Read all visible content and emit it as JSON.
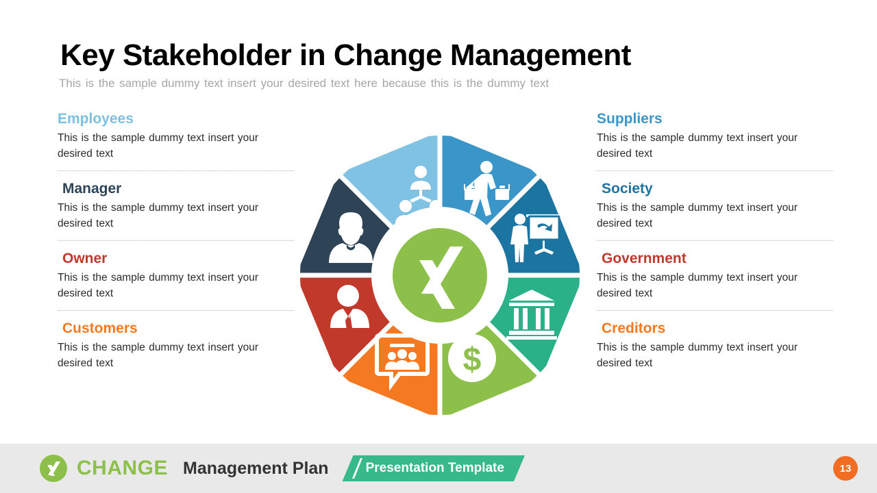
{
  "header": {
    "title": "Key Stakeholder in Change Management",
    "subtitle": "This is the sample  dummy  text insert your desired text here because this is the  dummy  text"
  },
  "body_text": "This is the sample dummy text insert your desired text",
  "left_column": [
    {
      "label": "Employees",
      "color": "#7dc0e0",
      "text": "This is the sample dummy text insert your desired text",
      "icon": "team-org-chart-icon"
    },
    {
      "label": "Manager",
      "color": "#2e4356",
      "text": "This is the sample dummy text insert your desired text",
      "icon": "person-bust-icon"
    },
    {
      "label": "Owner",
      "color": "#c0392b",
      "text": "This is the sample dummy text insert your desired text",
      "icon": "businessman-suit-icon"
    },
    {
      "label": "Customers",
      "color": "#f47920",
      "text": "This is the sample dummy text insert your desired text",
      "icon": "speech-bubble-people-icon"
    }
  ],
  "right_column": [
    {
      "label": "Suppliers",
      "color": "#3a96c8",
      "text": "This is the sample dummy text insert your desired text",
      "icon": "walking-briefcases-icon"
    },
    {
      "label": "Society",
      "color": "#1c74a0",
      "text": "This is the sample dummy text insert your desired text",
      "icon": "presenter-board-icon"
    },
    {
      "label": "Government",
      "color": "#c0392b",
      "text": "This is the sample dummy text insert your desired text",
      "icon": "bank-building-icon"
    },
    {
      "label": "Creditors",
      "color": "#f47920",
      "text": "This is the sample dummy text insert your desired text",
      "icon": "dollar-coin-icon"
    }
  ],
  "wheel": {
    "center_icon": "xing-logo-icon",
    "center_color": "#8cc04a",
    "segments": [
      {
        "name": "Employees",
        "color": "#7fc2e3",
        "icon": "team-org-chart-icon",
        "position": "top-left"
      },
      {
        "name": "Suppliers",
        "color": "#3a96c8",
        "icon": "walking-briefcases-icon",
        "position": "top-right"
      },
      {
        "name": "Society",
        "color": "#1c74a0",
        "icon": "presenter-board-icon",
        "position": "right-upper"
      },
      {
        "name": "Government",
        "color": "#2bb188",
        "icon": "bank-building-icon",
        "position": "right-lower"
      },
      {
        "name": "Creditors",
        "color": "#8cc04a",
        "icon": "dollar-coin-icon",
        "position": "bottom-right"
      },
      {
        "name": "Customers",
        "color": "#f47920",
        "icon": "speech-bubble-people-icon",
        "position": "bottom-left"
      },
      {
        "name": "Owner",
        "color": "#c0392b",
        "icon": "businessman-suit-icon",
        "position": "left-lower"
      },
      {
        "name": "Manager",
        "color": "#2e4356",
        "icon": "person-bust-icon",
        "position": "left-upper"
      }
    ]
  },
  "footer": {
    "logo_icon": "xing-logo-icon",
    "brand": "CHANGE",
    "brand_suffix": "Management Plan",
    "banner": "Presentation Template",
    "page_number": "13"
  }
}
